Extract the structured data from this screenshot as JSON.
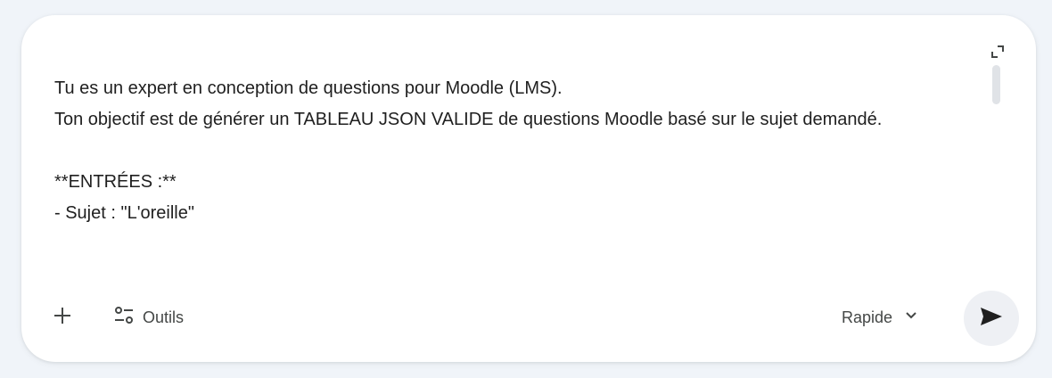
{
  "prompt": {
    "text": "Tu es un expert en conception de questions pour Moodle (LMS).\nTon objectif est de générer un TABLEAU JSON VALIDE de questions Moodle basé sur le sujet demandé.\n\n**ENTRÉES :**\n- Sujet : \"L'oreille\""
  },
  "toolbar": {
    "add_icon": "plus-icon",
    "tools_icon": "tools-sliders-icon",
    "tools_label": "Outils",
    "mode_label": "Rapide",
    "mode_icon": "chevron-down-icon",
    "send_icon": "send-icon",
    "expand_icon": "expand-icon"
  },
  "colors": {
    "page_background": "#f0f4f9",
    "card_background": "#ffffff",
    "text": "#1f1f1f",
    "secondary_text": "#444746",
    "send_button_background": "#eef0f4"
  }
}
